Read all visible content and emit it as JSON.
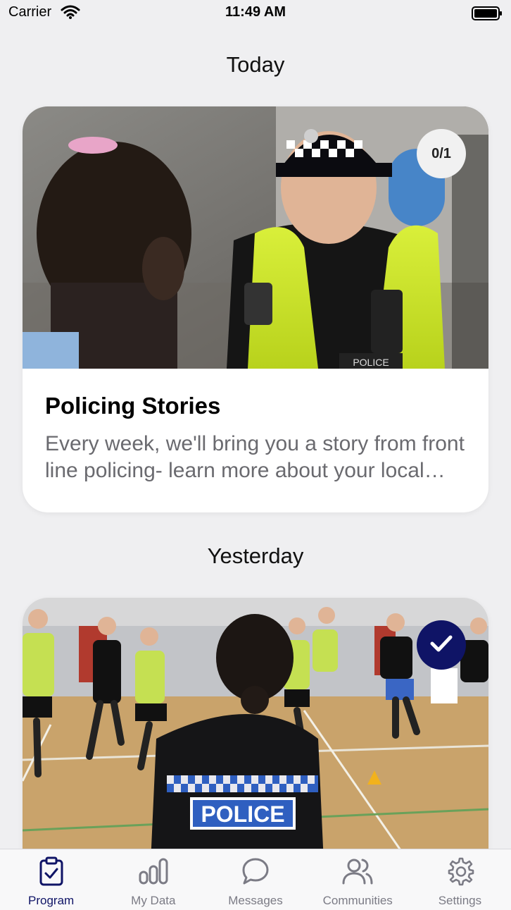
{
  "status_bar": {
    "carrier": "Carrier",
    "time": "11:49 AM"
  },
  "sections": [
    {
      "title": "Today",
      "card": {
        "badge": "0/1",
        "title": "Policing Stories",
        "description": "Every week, we'll bring you a story from front line policing- learn more about your local police force"
      }
    },
    {
      "title": "Yesterday",
      "card": {
        "completed": true,
        "vest_text": "POLICE"
      }
    }
  ],
  "card1_image": {
    "officer_badge_text": "POLICE"
  },
  "tab_bar": {
    "tabs": [
      {
        "label": "Program",
        "icon": "clipboard-check-icon",
        "active": true
      },
      {
        "label": "My Data",
        "icon": "bar-chart-icon",
        "active": false
      },
      {
        "label": "Messages",
        "icon": "chat-bubble-icon",
        "active": false
      },
      {
        "label": "Communities",
        "icon": "people-icon",
        "active": false
      },
      {
        "label": "Settings",
        "icon": "gear-icon",
        "active": false
      }
    ]
  },
  "colors": {
    "accent": "#0f1466",
    "background": "#efeff1",
    "inactive_tab": "#7b7b85"
  }
}
